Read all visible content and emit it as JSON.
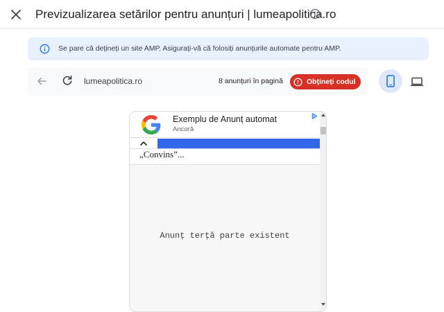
{
  "header": {
    "title": "Previzualizarea setărilor pentru anunțuri | lumeapolitica.ro"
  },
  "banner": {
    "text": "Se pare că dețineți un site AMP. Asigurați-vă că folosiți anunțurile automate pentru AMP."
  },
  "toolbar": {
    "url": "lumeapolitica.ro",
    "ad_count": "8 anunțuri în pagină",
    "get_code_label": "Obțineți codul"
  },
  "device": {
    "selected": "mobile"
  },
  "preview": {
    "ad_title": "Exemplu de Anunț automat",
    "ad_subtitle": "Ancoră",
    "quote": "„Convins”...",
    "placeholder": "Anunț terță parte existent"
  },
  "colors": {
    "accent_blue": "#1a73e8",
    "danger_red": "#d93025",
    "banner_bg": "#e8f0fe",
    "ad_bar_blue": "#3367eb"
  },
  "icons": [
    "close-icon",
    "info-icon",
    "back-arrow-icon",
    "reload-icon",
    "error-icon",
    "mobile-icon",
    "laptop-icon",
    "google-logo-icon",
    "adchoices-icon",
    "chevron-up-icon"
  ]
}
